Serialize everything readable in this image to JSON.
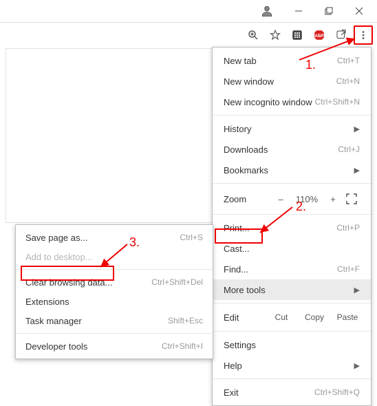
{
  "titlebar": {
    "profile_icon": "profile-avatar"
  },
  "toolbar": {
    "zoom_icon": "zoom-icon",
    "star_icon": "star-icon",
    "ext1_icon": "extension-grid-icon",
    "abp_icon": "abp-icon",
    "share_icon": "share-icon",
    "menu_icon": "more-vert-icon"
  },
  "menu": {
    "newtab": {
      "label": "New tab",
      "shortcut": "Ctrl+T"
    },
    "newwin": {
      "label": "New window",
      "shortcut": "Ctrl+N"
    },
    "incog": {
      "label": "New incognito window",
      "shortcut": "Ctrl+Shift+N"
    },
    "history": {
      "label": "History"
    },
    "downloads": {
      "label": "Downloads",
      "shortcut": "Ctrl+J"
    },
    "bookmarks": {
      "label": "Bookmarks"
    },
    "zoom": {
      "label": "Zoom",
      "minus": "–",
      "value": "110%",
      "plus": "+"
    },
    "print": {
      "label": "Print...",
      "shortcut": "Ctrl+P"
    },
    "cast": {
      "label": "Cast..."
    },
    "find": {
      "label": "Find...",
      "shortcut": "Ctrl+F"
    },
    "moretools": {
      "label": "More tools"
    },
    "edit": {
      "label": "Edit",
      "cut": "Cut",
      "copy": "Copy",
      "paste": "Paste"
    },
    "settings": {
      "label": "Settings"
    },
    "help": {
      "label": "Help"
    },
    "exit": {
      "label": "Exit",
      "shortcut": "Ctrl+Shift+Q"
    }
  },
  "submenu": {
    "savepage": {
      "label": "Save page as...",
      "shortcut": "Ctrl+S"
    },
    "adddesk": {
      "label": "Add to desktop..."
    },
    "clear": {
      "label": "Clear browsing data...",
      "shortcut": "Ctrl+Shift+Del"
    },
    "ext": {
      "label": "Extensions"
    },
    "taskmgr": {
      "label": "Task manager",
      "shortcut": "Shift+Esc"
    },
    "devtools": {
      "label": "Developer tools",
      "shortcut": "Ctrl+Shift+I"
    }
  },
  "annotations": {
    "step1": "1.",
    "step2": "2.",
    "step3": "3."
  }
}
